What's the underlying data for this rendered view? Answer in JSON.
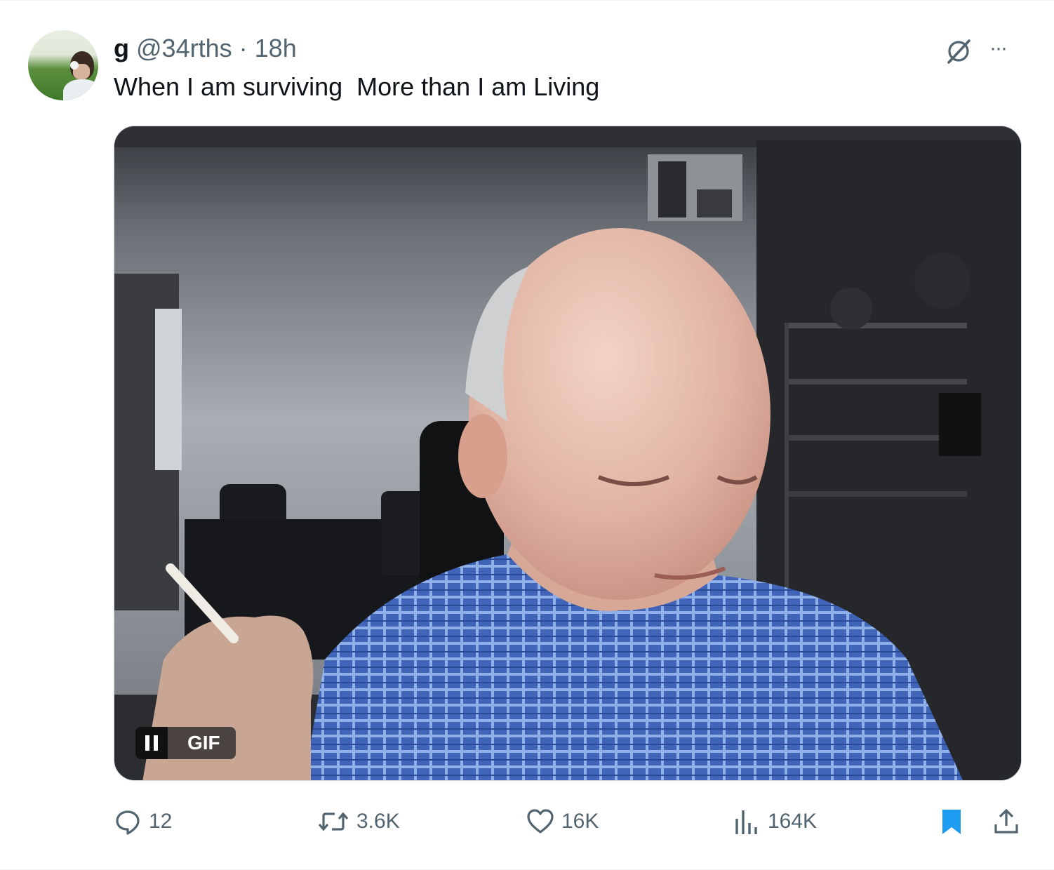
{
  "tweet": {
    "author_name": "g",
    "handle": "@34rths",
    "separator": "·",
    "time": "18h",
    "text": "When I am surviving  More than I am Living",
    "more_label": "···"
  },
  "media": {
    "badge_label": "GIF"
  },
  "actions": {
    "replies": "12",
    "reposts": "3.6K",
    "likes": "16K",
    "views": "164K"
  },
  "colors": {
    "bookmark_active": "#1d9bf0",
    "muted_text": "#536471",
    "text": "#0f1419"
  },
  "icons": [
    "grok-icon",
    "more-icon",
    "pause-icon",
    "reply-icon",
    "repost-icon",
    "like-icon",
    "views-icon",
    "bookmark-icon",
    "share-icon"
  ]
}
